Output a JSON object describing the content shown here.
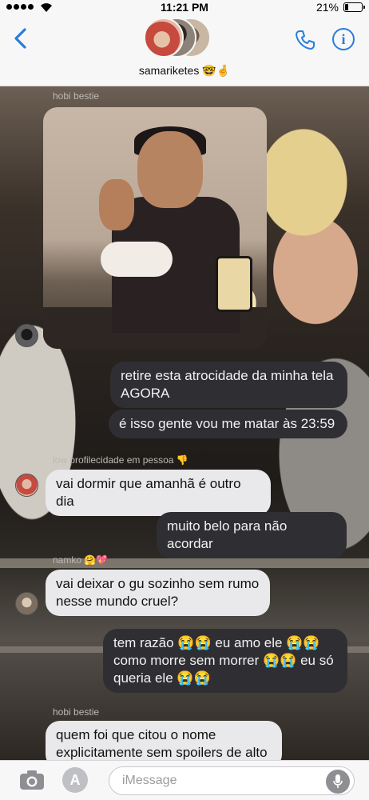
{
  "status": {
    "time": "11:21 PM",
    "battery": "21%",
    "battery_level": 0.21
  },
  "header": {
    "group_name": "samariketes 🤓🤞",
    "info_label": "i"
  },
  "messages": [
    {
      "sender": "hobi bestie"
    },
    {
      "text": "retire esta atrocidade da minha tela AGORA"
    },
    {
      "text": "é isso gente vou me matar às 23:59"
    },
    {
      "sender": "low profilecidade em pessoa 👎"
    },
    {
      "text": "vai dormir que amanhã é outro dia"
    },
    {
      "text": "muito belo para não acordar"
    },
    {
      "sender": "namko 🤗💖"
    },
    {
      "text": "vai deixar o gu sozinho sem rumo nesse mundo cruel?"
    },
    {
      "text": "tem razão 😭😭 eu amo ele 😭😭 como morre sem morrer 😭😭 eu só queria ele 😭😭"
    },
    {
      "sender": "hobi bestie"
    },
    {
      "text": "quem foi que citou o nome explicitamente sem spoilers de alto"
    }
  ],
  "composer": {
    "placeholder": "iMessage",
    "appstore_label": "A"
  },
  "colors": {
    "accent": "#2a7ddb",
    "incoming": "#e9e9eb",
    "outgoing": "#2f2f33"
  },
  "icons": [
    "back-chevron",
    "phone",
    "info",
    "camera",
    "appstore",
    "microphone"
  ]
}
